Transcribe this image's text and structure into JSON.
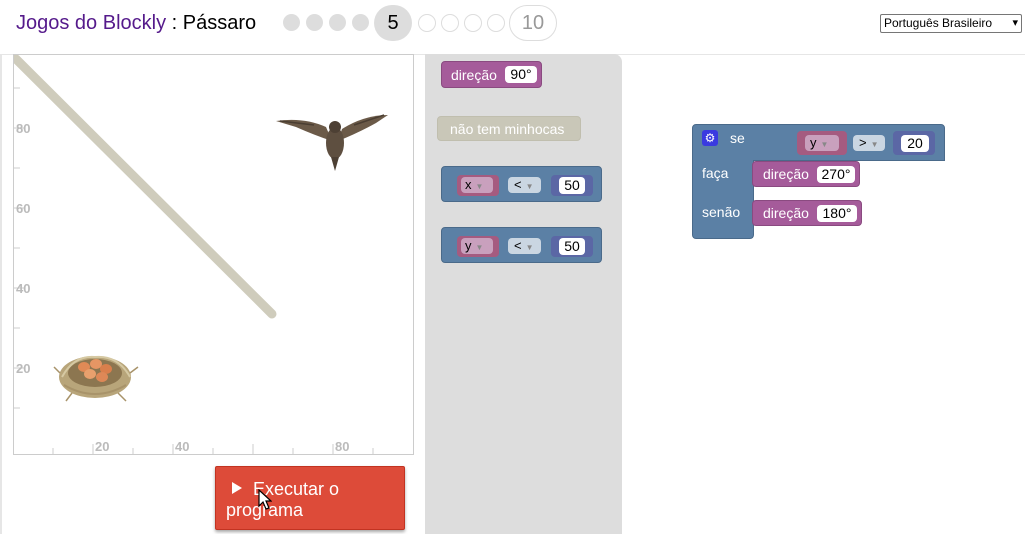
{
  "header": {
    "app_title": "Jogos do Blockly",
    "separator": " : ",
    "game_name": "Pássaro",
    "levels": {
      "current": "5",
      "last": "10"
    },
    "language": "Português Brasileiro"
  },
  "stage": {
    "y_labels": [
      "80",
      "60",
      "40",
      "20"
    ],
    "x_labels": [
      "20",
      "40",
      "80"
    ]
  },
  "run_button": {
    "label": "Executar o programa"
  },
  "toolbox": {
    "direction_block": {
      "label": "direção",
      "value": "90°"
    },
    "no_worm_block": {
      "label": "não tem minhocas"
    },
    "compare_x": {
      "var": "x",
      "op": "<",
      "value": "50"
    },
    "compare_y": {
      "var": "y",
      "op": "<",
      "value": "50"
    }
  },
  "workspace": {
    "if_block": {
      "if_label": "se",
      "do_label": "faça",
      "else_label": "senão",
      "condition": {
        "var": "y",
        "op": ">",
        "value": "20"
      },
      "do_action": {
        "label": "direção",
        "value": "270°"
      },
      "else_action": {
        "label": "direção",
        "value": "180°"
      }
    }
  },
  "colors": {
    "title_link": "#551a8b",
    "run_button": "#dd4b39",
    "heading_block": "#a55b9a",
    "logic_block": "#5b80a5",
    "variable": "#a55b80",
    "number": "#5b67a5"
  }
}
